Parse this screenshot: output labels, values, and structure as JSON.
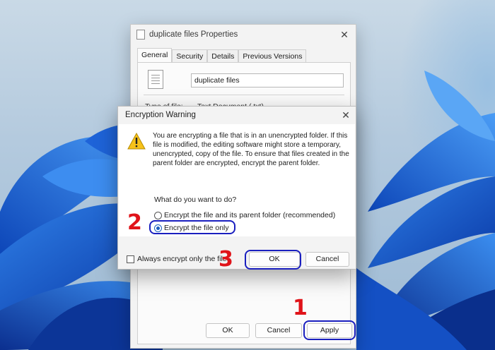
{
  "properties_window": {
    "title": "duplicate files Properties",
    "tabs": [
      "General",
      "Security",
      "Details",
      "Previous Versions"
    ],
    "file_name": "duplicate files",
    "type_label": "Type of file:",
    "type_value": "Text Document (.txt)",
    "buttons": {
      "ok": "OK",
      "cancel": "Cancel",
      "apply": "Apply"
    }
  },
  "encryption_dialog": {
    "title": "Encryption Warning",
    "message": "You are encrypting a file that is in an unencrypted folder. If this file is modified, the editing software might store a temporary, unencrypted, copy of the file. To ensure that files created in the parent folder are encrypted, encrypt the parent folder.",
    "question": "What do you want to do?",
    "options": [
      {
        "label": "Encrypt the file and its parent folder (recommended)",
        "selected": false
      },
      {
        "label": "Encrypt the file only",
        "selected": true
      }
    ],
    "checkbox_label": "Always encrypt only the file",
    "checkbox_checked": false,
    "buttons": {
      "ok": "OK",
      "cancel": "Cancel"
    }
  },
  "step_markers": [
    "1",
    "2",
    "3"
  ],
  "colors": {
    "highlight": "#1a1fbf",
    "step_number": "#e0141a",
    "accent": "#1a5fc0"
  },
  "icons": [
    "file-icon",
    "close-icon",
    "warning-icon"
  ]
}
